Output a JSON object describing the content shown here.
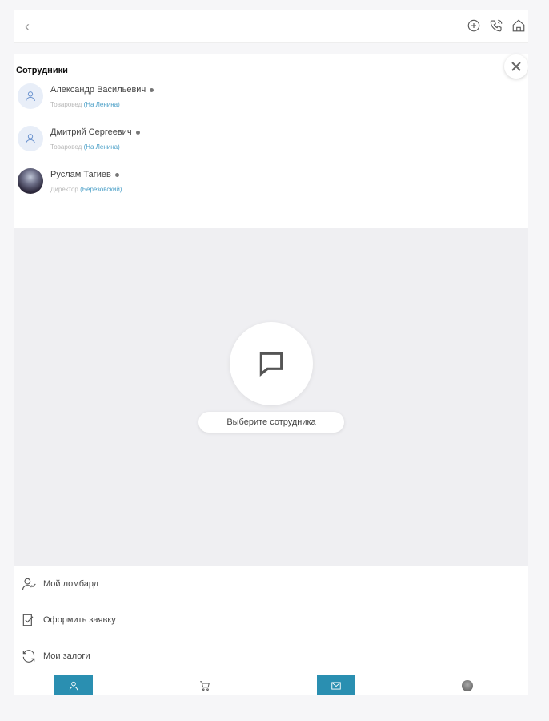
{
  "topbar": {
    "back_icon": "chevron-left-icon",
    "icons": [
      "plus-circle-icon",
      "phone-icon",
      "home-icon"
    ]
  },
  "employees": {
    "title": "Сотрудники",
    "items": [
      {
        "name": "Александр Васильевич",
        "role": "Товаровед",
        "branch": "(На Ленина)",
        "avatar": "user-icon",
        "online": true
      },
      {
        "name": "Дмитрий Сергеевич",
        "role": "Товаровед",
        "branch": "(На Ленина)",
        "avatar": "user-icon",
        "online": true
      },
      {
        "name": "Руслам Тагиев",
        "role": "Директор",
        "branch": "(Березовский)",
        "avatar": "photo",
        "online": true
      }
    ]
  },
  "chat": {
    "prompt": "Выберите сотрудника",
    "icon": "chat-bubble-icon"
  },
  "menu": {
    "items": [
      {
        "label": "Мой ломбард",
        "icon": "user-check-icon"
      },
      {
        "label": "Оформить заявку",
        "icon": "checkbox-edit-icon"
      },
      {
        "label": "Мои залоги",
        "icon": "refresh-icon"
      }
    ]
  },
  "tabs": [
    {
      "name": "profile",
      "icon": "user-icon",
      "active": true
    },
    {
      "name": "cart",
      "icon": "cart-icon",
      "active": false
    },
    {
      "name": "messages",
      "icon": "mail-icon",
      "active": true
    },
    {
      "name": "account",
      "icon": "avatar",
      "active": false
    }
  ],
  "colors": {
    "accent": "#2a8fb1",
    "link": "#4a9fc7",
    "chat_bg": "#efeff2"
  }
}
